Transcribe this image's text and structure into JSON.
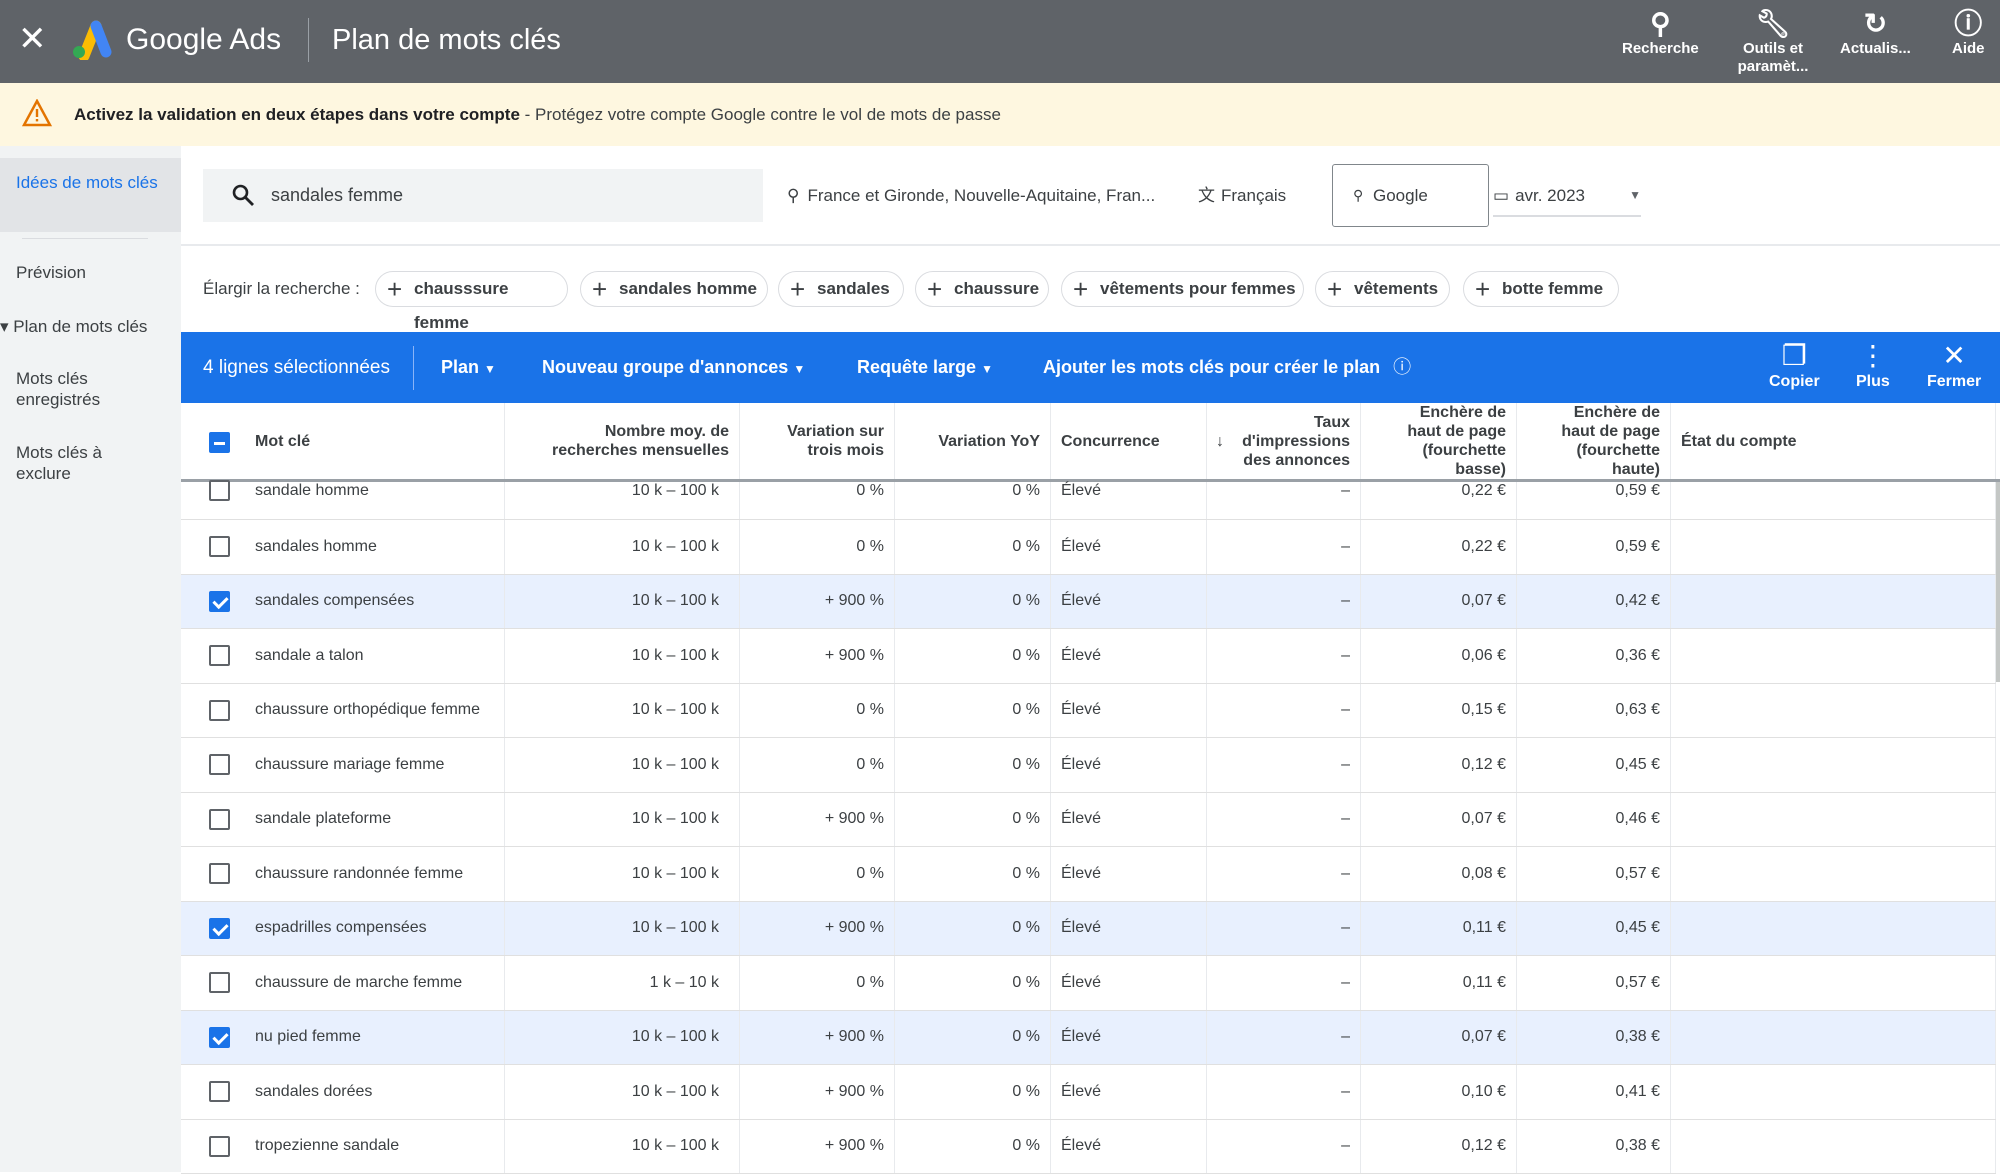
{
  "topbar": {
    "brand": "Google Ads",
    "title": "Plan de mots clés",
    "buttons": [
      {
        "label": "Recherche",
        "icon": "search-icon"
      },
      {
        "label": "Outils et\nparamèt...",
        "icon": "wrench-icon"
      },
      {
        "label": "Actualis...",
        "icon": "refresh-icon"
      },
      {
        "label": "Aide",
        "icon": "help-icon"
      }
    ]
  },
  "banner": {
    "bold": "Activez la validation en deux étapes dans votre compte",
    "text": " - Protégez votre compte Google contre le vol de mots de passe"
  },
  "sidebar": {
    "items": [
      {
        "label": "Idées de mots clés",
        "selected": true
      },
      {
        "label": "Prévision"
      },
      {
        "label": "▾ Plan de mots clés"
      },
      {
        "label": "Mots clés enregistrés"
      },
      {
        "label": "Mots clés à exclure"
      }
    ]
  },
  "search": {
    "value": "sandales femme",
    "location": "France et Gironde, Nouvelle-Aquitaine, Fran...",
    "language": "Français",
    "network": "Google",
    "date": "avr. 2023"
  },
  "broaden": {
    "label": "Élargir la recherche :",
    "chips": [
      "chausssure femme",
      "sandales homme",
      "sandales",
      "chaussure",
      "vêtements pour femmes",
      "vêtements",
      "botte femme"
    ]
  },
  "selection_bar": {
    "count": "4 lignes sélectionnées",
    "plan": "Plan",
    "ad_group": "Nouveau groupe d'annonces",
    "match": "Requête large",
    "add": "Ajouter les mots clés pour créer le plan",
    "copy": "Copier",
    "more": "Plus",
    "close": "Fermer",
    "color": "#1a73e8"
  },
  "table": {
    "headers": [
      "Mot clé",
      "Nombre moy. de recherches mensuelles",
      "Variation sur trois mois",
      "Variation YoY",
      "Concurrence",
      "Taux d'impressions des annonces",
      "Enchère de haut de page (fourchette basse)",
      "Enchère de haut de page (fourchette haute)",
      "État du compte"
    ],
    "sorted_column": "Taux d'impressions des annonces",
    "rows": [
      {
        "selected": false,
        "cells": [
          "sandale homme",
          "10 k – 100 k",
          "0 %",
          "0 %",
          "Élevé",
          "–",
          "0,22 €",
          "0,59 €",
          ""
        ]
      },
      {
        "selected": false,
        "cells": [
          "sandales homme",
          "10 k – 100 k",
          "0 %",
          "0 %",
          "Élevé",
          "–",
          "0,22 €",
          "0,59 €",
          ""
        ]
      },
      {
        "selected": true,
        "cells": [
          "sandales compensées",
          "10 k – 100 k",
          "+ 900 %",
          "0 %",
          "Élevé",
          "–",
          "0,07 €",
          "0,42 €",
          ""
        ]
      },
      {
        "selected": false,
        "cells": [
          "sandale a talon",
          "10 k – 100 k",
          "+ 900 %",
          "0 %",
          "Élevé",
          "–",
          "0,06 €",
          "0,36 €",
          ""
        ]
      },
      {
        "selected": false,
        "cells": [
          "chaussure orthopédique femme",
          "10 k – 100 k",
          "0 %",
          "0 %",
          "Élevé",
          "–",
          "0,15 €",
          "0,63 €",
          ""
        ]
      },
      {
        "selected": false,
        "cells": [
          "chaussure mariage femme",
          "10 k – 100 k",
          "0 %",
          "0 %",
          "Élevé",
          "–",
          "0,12 €",
          "0,45 €",
          ""
        ]
      },
      {
        "selected": false,
        "cells": [
          "sandale plateforme",
          "10 k – 100 k",
          "+ 900 %",
          "0 %",
          "Élevé",
          "–",
          "0,07 €",
          "0,46 €",
          ""
        ]
      },
      {
        "selected": false,
        "cells": [
          "chaussure randonnée femme",
          "10 k – 100 k",
          "0 %",
          "0 %",
          "Élevé",
          "–",
          "0,08 €",
          "0,57 €",
          ""
        ]
      },
      {
        "selected": true,
        "cells": [
          "espadrilles compensées",
          "10 k – 100 k",
          "+ 900 %",
          "0 %",
          "Élevé",
          "–",
          "0,11 €",
          "0,45 €",
          ""
        ]
      },
      {
        "selected": false,
        "cells": [
          "chaussure de marche femme",
          "1 k – 10 k",
          "0 %",
          "0 %",
          "Élevé",
          "–",
          "0,11 €",
          "0,57 €",
          ""
        ]
      },
      {
        "selected": true,
        "cells": [
          "nu pied femme",
          "10 k – 100 k",
          "+ 900 %",
          "0 %",
          "Élevé",
          "–",
          "0,07 €",
          "0,38 €",
          ""
        ]
      },
      {
        "selected": false,
        "cells": [
          "sandales dorées",
          "10 k – 100 k",
          "+ 900 %",
          "0 %",
          "Élevé",
          "–",
          "0,10 €",
          "0,41 €",
          ""
        ]
      },
      {
        "selected": false,
        "cells": [
          "tropezienne sandale",
          "10 k – 100 k",
          "+ 900 %",
          "0 %",
          "Élevé",
          "–",
          "0,12 €",
          "0,38 €",
          ""
        ]
      }
    ]
  }
}
